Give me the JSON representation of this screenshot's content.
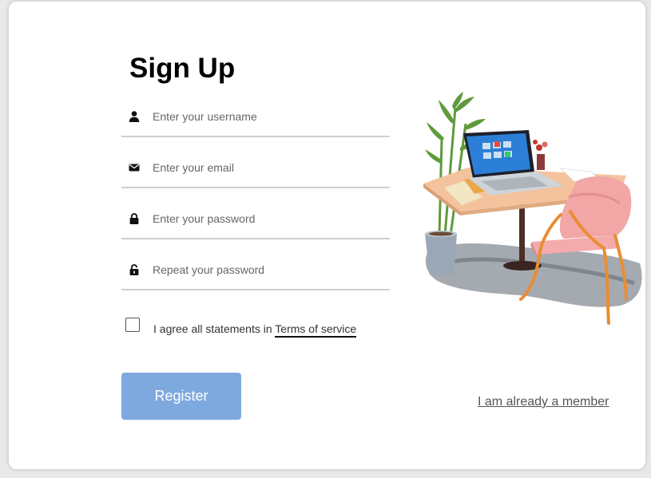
{
  "form": {
    "title": "Sign Up",
    "fields": [
      {
        "icon": "user-icon",
        "placeholder": "Enter your username",
        "value": ""
      },
      {
        "icon": "envelope-icon",
        "placeholder": "Enter your email",
        "value": ""
      },
      {
        "icon": "lock-icon",
        "placeholder": "Enter your password",
        "value": ""
      },
      {
        "icon": "unlock-icon",
        "placeholder": "Repeat your password",
        "value": ""
      }
    ],
    "agree_text": "I agree all statements in ",
    "terms_link": "Terms of service",
    "agree_checked": false,
    "register_label": "Register",
    "member_link": "I am already a member"
  },
  "colors": {
    "register_button": "#7ea9df",
    "field_underline": "#cfcfcf"
  }
}
